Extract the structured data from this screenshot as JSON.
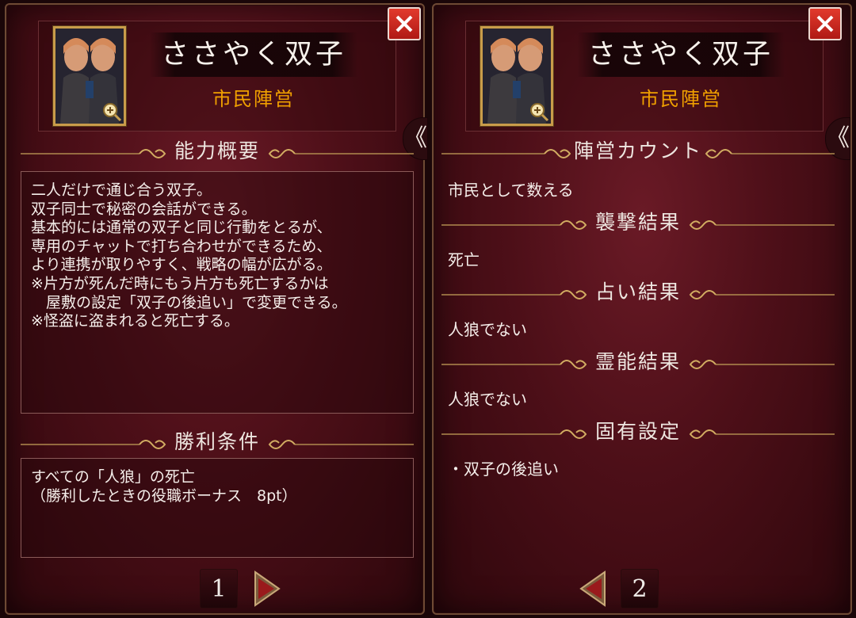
{
  "close_icon": "close-x-icon",
  "colors": {
    "accent_gold": "#f0a000",
    "close_red": "#d42a20",
    "panel_bg": "#4d0f18"
  },
  "panels": [
    {
      "title": "ささやく双子",
      "faction": "市民陣営",
      "side_tab": "《",
      "sections": {
        "ability": {
          "title": "能力概要",
          "lines": [
            "二人だけで通じ合う双子。",
            "双子同士で秘密の会話ができる。",
            "基本的には通常の双子と同じ行動をとるが、",
            "専用のチャットで打ち合わせができるため、",
            "より連携が取りやすく、戦略の幅が広がる。",
            "※片方が死んだ時にもう片方も死亡するかは",
            "　屋敷の設定「双子の後追い」で変更できる。",
            "※怪盗に盗まれると死亡する。"
          ]
        },
        "victory": {
          "title": "勝利条件",
          "lines": [
            "すべての「人狼」の死亡",
            "（勝利したときの役職ボーナス　8pt）"
          ]
        }
      },
      "page_number": "1"
    },
    {
      "title": "ささやく双子",
      "faction": "市民陣営",
      "side_tab": "《",
      "sections": {
        "faction_count": {
          "title": "陣営カウント",
          "value": "市民として数える"
        },
        "attack_result": {
          "title": "襲撃結果",
          "value": "死亡"
        },
        "divination_result": {
          "title": "占い結果",
          "value": "人狼でない"
        },
        "medium_result": {
          "title": "霊能結果",
          "value": "人狼でない"
        },
        "unique_settings": {
          "title": "固有設定",
          "value": "・双子の後追い"
        }
      },
      "page_number": "2"
    }
  ]
}
